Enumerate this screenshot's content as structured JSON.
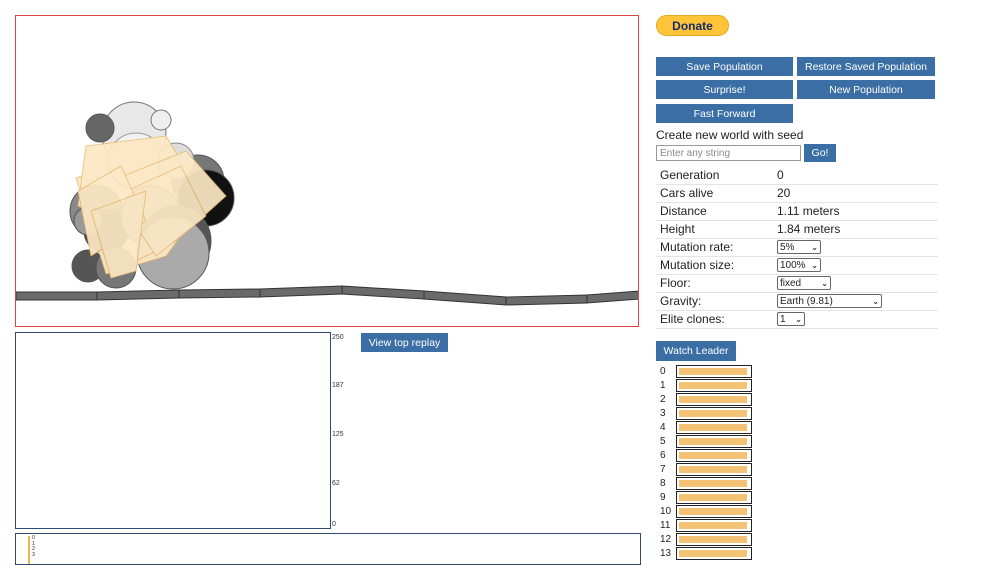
{
  "donate": {
    "label": "Donate"
  },
  "buttons": {
    "save_population": "Save Population",
    "restore_population": "Restore Saved Population",
    "surprise": "Surprise!",
    "new_population": "New Population",
    "fast_forward": "Fast Forward",
    "go": "Go!",
    "view_top_replay": "View top replay",
    "watch_leader": "Watch Leader"
  },
  "seed": {
    "title": "Create new world with seed",
    "placeholder": "Enter any string",
    "value": ""
  },
  "stats": {
    "generation": {
      "label": "Generation",
      "value": "0"
    },
    "cars_alive": {
      "label": "Cars alive",
      "value": "20"
    },
    "distance": {
      "label": "Distance",
      "value": "1.11 meters"
    },
    "height": {
      "label": "Height",
      "value": "1.84 meters"
    },
    "mutation_rate": {
      "label": "Mutation rate:",
      "value": "5%"
    },
    "mutation_size": {
      "label": "Mutation size:",
      "value": "100%"
    },
    "floor": {
      "label": "Floor:",
      "value": "fixed"
    },
    "gravity": {
      "label": "Gravity:",
      "value": "Earth (9.81)"
    },
    "elite_clones": {
      "label": "Elite clones:",
      "value": "1"
    }
  },
  "graph": {
    "y_ticks": [
      "250",
      "187",
      "125",
      "62",
      "0"
    ]
  },
  "minimap": {
    "labels": [
      "0",
      "1",
      "2",
      "3"
    ]
  },
  "leaders": [
    {
      "rank": "0",
      "health": 0.95
    },
    {
      "rank": "1",
      "health": 0.95
    },
    {
      "rank": "2",
      "health": 0.95
    },
    {
      "rank": "3",
      "health": 0.95
    },
    {
      "rank": "4",
      "health": 0.95
    },
    {
      "rank": "5",
      "health": 0.95
    },
    {
      "rank": "6",
      "health": 0.95
    },
    {
      "rank": "7",
      "health": 0.95
    },
    {
      "rank": "8",
      "health": 0.95
    },
    {
      "rank": "9",
      "health": 0.95
    },
    {
      "rank": "10",
      "health": 0.95
    },
    {
      "rank": "11",
      "health": 0.95
    },
    {
      "rank": "12",
      "health": 0.95
    },
    {
      "rank": "13",
      "health": 0.95
    }
  ],
  "colors": {
    "button": "#3a6ea5",
    "donate": "#ffc439",
    "health": "#f3c274",
    "canvas_border": "#dd4444"
  }
}
